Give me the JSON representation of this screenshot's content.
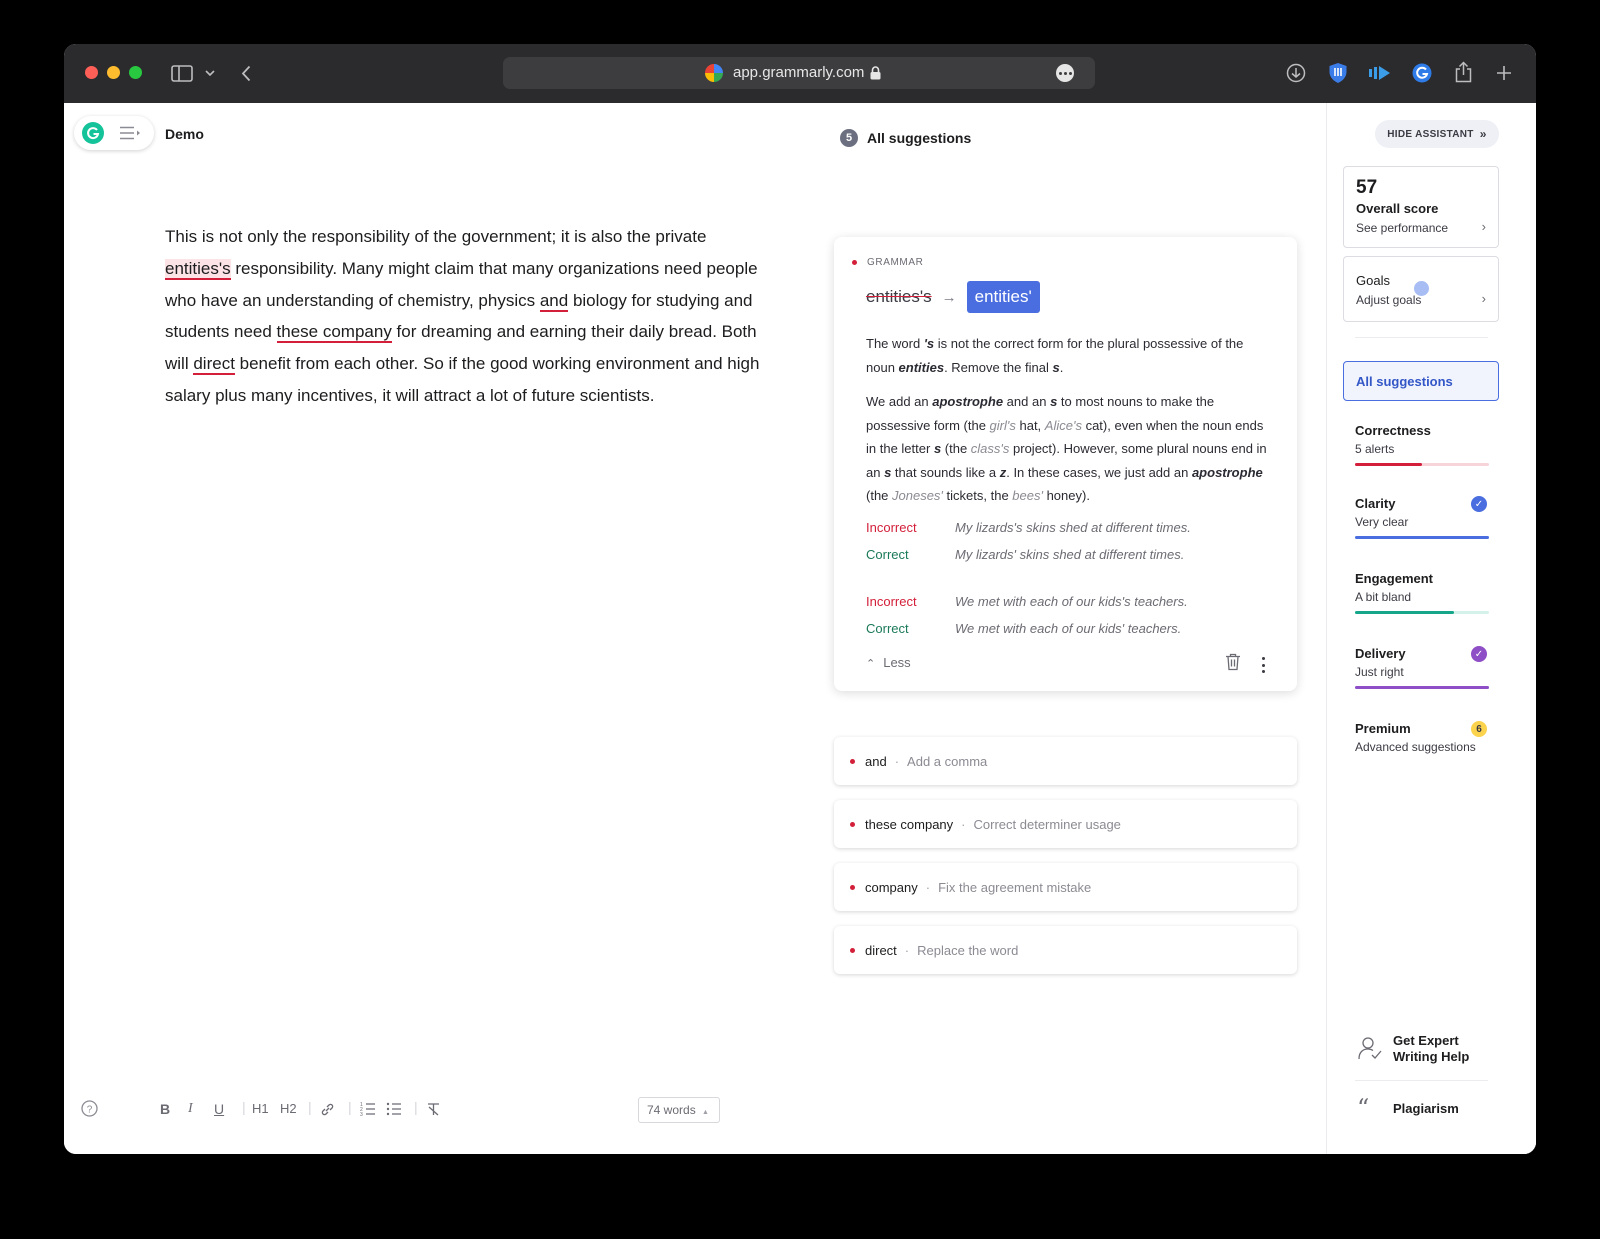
{
  "browser": {
    "url": "app.grammarly.com"
  },
  "editor": {
    "doc_title": "Demo",
    "text": {
      "p1": "This is not only the responsibility of the government; it is also the private ",
      "e1": "entities's",
      "p2": " responsibility. Many might claim that many organizations need people who have an understanding of chemistry, physics ",
      "e2": "and",
      "p3": " biology for studying and students need ",
      "e3": "these company",
      "p4": " for dreaming and earning their daily bread. Both will ",
      "e4": "direct",
      "p5": " benefit from each other.  So if the good working environment and high salary plus many incentives, it will attract a lot of future scientists."
    },
    "toolbar": {
      "bold": "B",
      "italic": "I",
      "underline": "U",
      "h1": "H1",
      "h2": "H2",
      "word_count": "74 words"
    }
  },
  "suggestions": {
    "count": "5",
    "heading": "All suggestions",
    "card": {
      "category": "GRAMMAR",
      "original": "entities's",
      "replacement": "entities'",
      "expl1": {
        "a": "The word ",
        "b": "'s",
        "c": " is not the correct form for the plural possessive of the noun ",
        "d": "entities",
        "e": ". Remove the final ",
        "f": "s",
        "g": "."
      },
      "expl2": {
        "a": "We add an ",
        "b": "apostrophe",
        "c": " and an ",
        "d": "s",
        "e": " to most nouns to make the possessive form (the ",
        "f": "girl's",
        "g": " hat, ",
        "h": "Alice's",
        "i": " cat), even when the noun ends in the letter ",
        "j": "s",
        "k": " (the ",
        "l": "class's",
        "m": " project). However, some plural nouns end in an ",
        "n": "s",
        "o": " that sounds like a ",
        "p": "z",
        "q": ". In these cases, we just add an ",
        "r": "apostrophe",
        "s": " (the ",
        "t": "Joneses'",
        "u": " tickets, the ",
        "v": "bees'",
        "w": " honey)."
      },
      "examples": [
        {
          "label": "Incorrect",
          "text": "My lizards's skins shed at different times."
        },
        {
          "label": "Correct",
          "text": "My lizards' skins shed at different times."
        },
        {
          "label": "Incorrect",
          "text": "We met with each of our kids's teachers."
        },
        {
          "label": "Correct",
          "text": "We met with each of our kids' teachers."
        }
      ],
      "less": "Less"
    },
    "items": [
      {
        "word": "and",
        "desc": "Add a comma"
      },
      {
        "word": "these company",
        "desc": "Correct determiner usage"
      },
      {
        "word": "company",
        "desc": "Fix the agreement mistake"
      },
      {
        "word": "direct",
        "desc": "Replace the word"
      }
    ]
  },
  "assistant": {
    "hide_label": "HIDE ASSISTANT",
    "score": {
      "value": "57",
      "title": "Overall score",
      "link": "See performance"
    },
    "goals": {
      "title": "Goals",
      "link": "Adjust goals"
    },
    "all_suggestions": "All suggestions",
    "metrics": [
      {
        "title": "Correctness",
        "status": "5 alerts",
        "level": 0.5,
        "color": "#d31f39"
      },
      {
        "title": "Clarity",
        "status": "Very clear",
        "level": 1.0,
        "color": "#4a6ee0"
      },
      {
        "title": "Engagement",
        "status": "A bit bland",
        "level": 0.74,
        "color": "#15a68a"
      },
      {
        "title": "Delivery",
        "status": "Just right",
        "level": 1.0,
        "color": "#8e4ec6"
      },
      {
        "title": "Premium",
        "status": "Advanced suggestions",
        "badge": "6"
      }
    ],
    "expert": {
      "line1": "Get Expert",
      "line2": "Writing Help"
    },
    "plagiarism": "Plagiarism"
  },
  "colors": {
    "accent": "#4a6ee0",
    "error": "#d31f39",
    "brand": "#15c39a"
  }
}
